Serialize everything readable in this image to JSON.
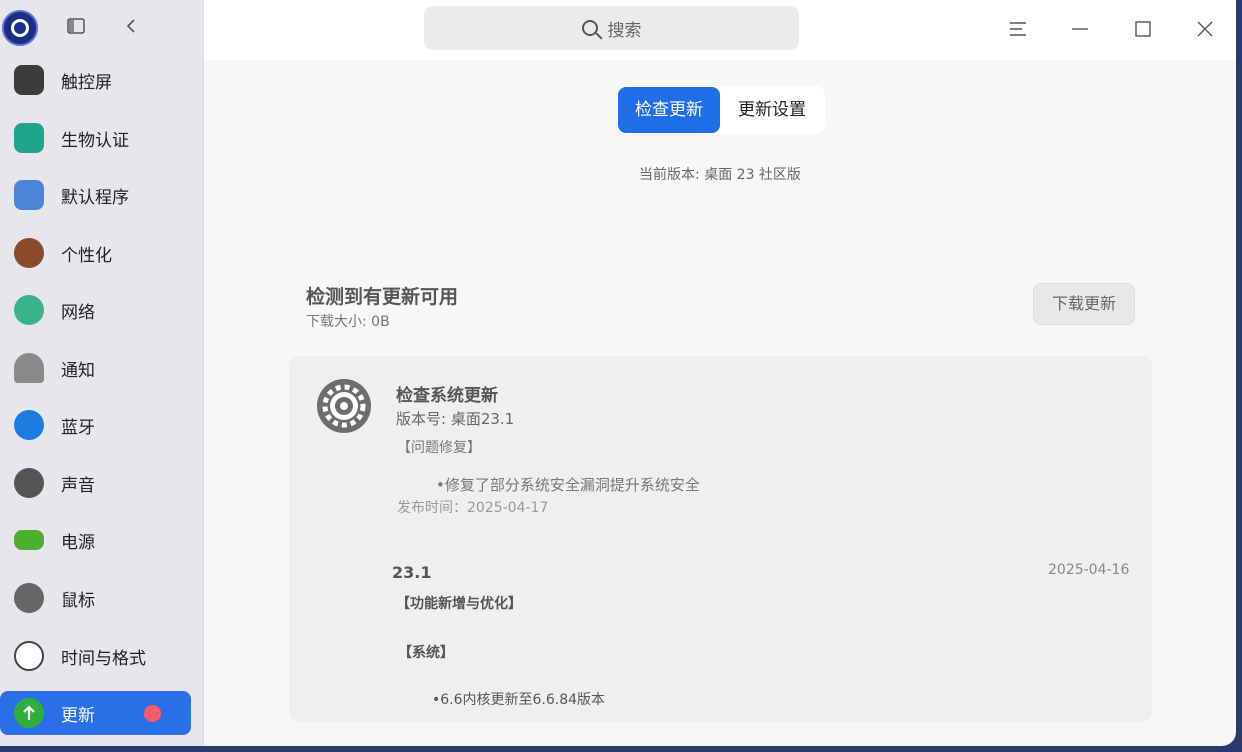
{
  "sidebar": {
    "items": [
      {
        "label": "触控屏",
        "icon": "touchscreen-icon",
        "color": "#3b3b3b"
      },
      {
        "label": "生物认证",
        "icon": "fingerprint-icon",
        "color": "#1fa58e"
      },
      {
        "label": "默认程序",
        "icon": "default-apps-icon",
        "color": "#4c84d8"
      },
      {
        "label": "个性化",
        "icon": "palette-icon",
        "color": "#8a4b2d"
      },
      {
        "label": "网络",
        "icon": "network-globe-icon",
        "color": "#3ab28a"
      },
      {
        "label": "通知",
        "icon": "bell-icon",
        "color": "#8a8a8a"
      },
      {
        "label": "蓝牙",
        "icon": "bluetooth-icon",
        "color": "#1e7be0"
      },
      {
        "label": "声音",
        "icon": "speaker-icon",
        "color": "#555555"
      },
      {
        "label": "电源",
        "icon": "battery-icon",
        "color": "#4caf2f"
      },
      {
        "label": "鼠标",
        "icon": "mouse-icon",
        "color": "#666666"
      },
      {
        "label": "时间与格式",
        "icon": "clock-icon",
        "color": "#444444"
      },
      {
        "label": "更新",
        "icon": "update-arrow-icon",
        "color": "#2fae3c",
        "active": true
      }
    ]
  },
  "search": {
    "placeholder": "搜索"
  },
  "tabs": {
    "check": "检查更新",
    "settings": "更新设置"
  },
  "version_text": "当前版本: 桌面 23 社区版",
  "available": {
    "title": "检测到有更新可用",
    "size": "下载大小: 0B",
    "download_button": "下载更新"
  },
  "update": {
    "title": "检查系统更新",
    "version": "版本号: 桌面23.1",
    "section": "【问题修复】",
    "bullet": "修复了部分系统安全漏洞提升系统安全",
    "release": "发布时间：2025-04-17"
  },
  "history": {
    "version": "23.1",
    "date": "2025-04-16",
    "section1": "【功能新增与优化】",
    "section2": "【系统】",
    "bullet": "6.6内核更新至6.6.84版本"
  },
  "colors": {
    "accent": "#1f6ee8",
    "badge": "#ff5b6a"
  }
}
